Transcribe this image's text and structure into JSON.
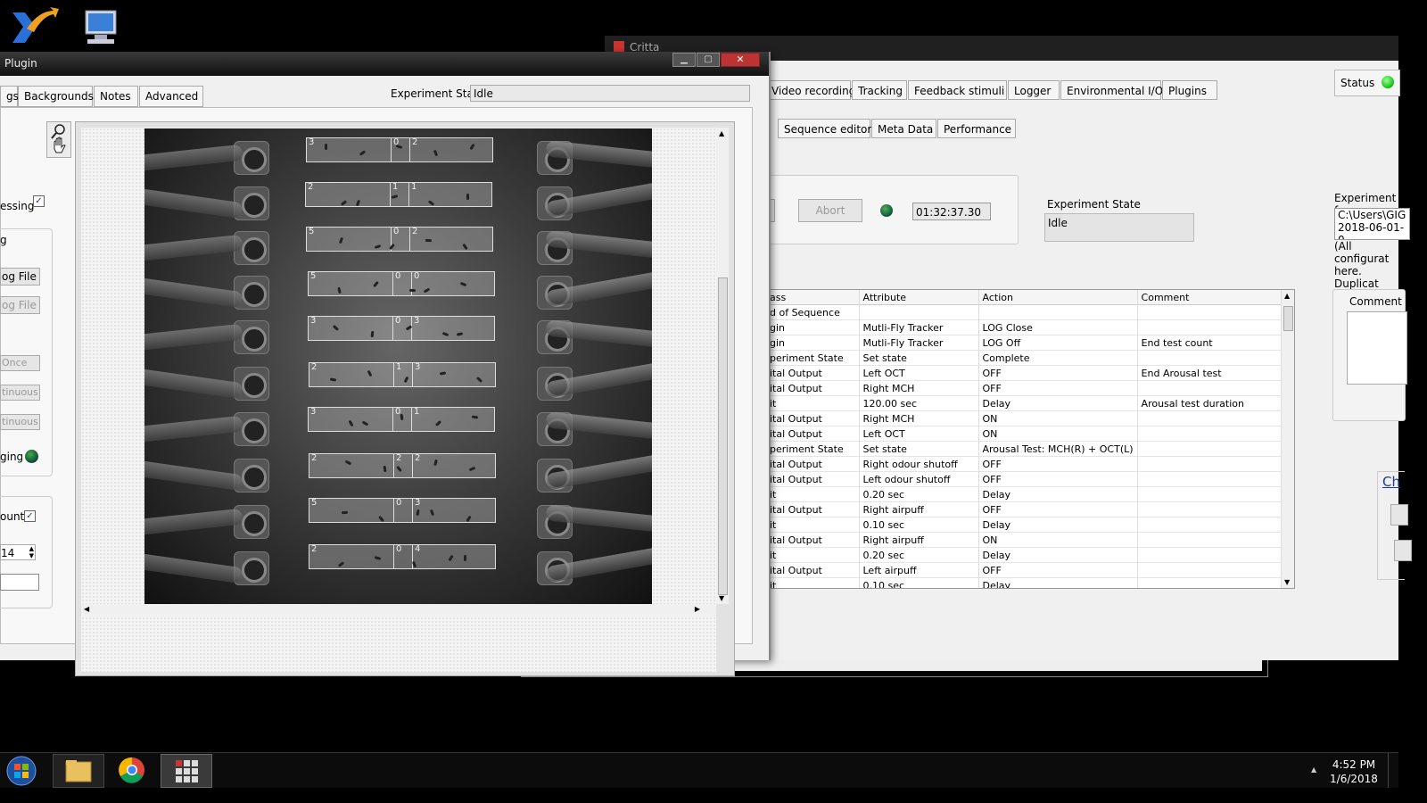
{
  "desktop": {
    "icons": [
      {
        "name": "app-shortcut-icon"
      },
      {
        "name": "computer-icon",
        "label": "Computer"
      }
    ]
  },
  "back_window": {
    "title": "Critta",
    "status_label": "Status",
    "status_color": "#22cc22",
    "tabs": [
      "Video recording",
      "Tracking",
      "Feedback stimuli",
      "Logger",
      "Environmental I/O",
      "Plugins"
    ],
    "subtabs": [
      "Sequence editor",
      "Meta Data",
      "Performance"
    ],
    "abort_label": "Abort",
    "timer_value": "01:32:37.30",
    "experiment_state_label": "Experiment State",
    "experiment_state_value": "Idle",
    "experiment_folder_label": "Experiment fo",
    "experiment_folder_value_1": "C:\\Users\\GIG",
    "experiment_folder_value_2": "2018-06-01-0",
    "experiment_note_1": "(All configurat",
    "experiment_note_2": "here. Duplicat",
    "comment_label": "Comment",
    "ch_label": "Ch",
    "table": {
      "headers": [
        "ass",
        "Attribute",
        "Action",
        "Comment"
      ],
      "rows": [
        [
          "d of Sequence",
          "",
          "",
          ""
        ],
        [
          "gin",
          "Mutli-Fly Tracker",
          "LOG Close",
          ""
        ],
        [
          "gin",
          "Mutli-Fly Tracker",
          "LOG Off",
          "End test count"
        ],
        [
          "periment State",
          "Set state",
          "Complete",
          ""
        ],
        [
          "ital Output",
          "Left OCT",
          "OFF",
          "End Arousal test"
        ],
        [
          "ital Output",
          "Right MCH",
          "OFF",
          ""
        ],
        [
          "it",
          "120.00 sec",
          "Delay",
          "Arousal test duration"
        ],
        [
          "ital Output",
          "Right MCH",
          "ON",
          ""
        ],
        [
          "ital Output",
          "Left OCT",
          "ON",
          ""
        ],
        [
          "periment State",
          "Set state",
          "Arousal Test: MCH(R) + OCT(L)",
          ""
        ],
        [
          "ital Output",
          "Right odour shutoff",
          "OFF",
          ""
        ],
        [
          "ital Output",
          "Left odour shutoff",
          "OFF",
          ""
        ],
        [
          "it",
          "0.20 sec",
          "Delay",
          ""
        ],
        [
          "ital Output",
          "Right airpuff",
          "OFF",
          ""
        ],
        [
          "it",
          "0.10 sec",
          "Delay",
          ""
        ],
        [
          "ital Output",
          "Right airpuff",
          "ON",
          ""
        ],
        [
          "it",
          "0.20 sec",
          "Delay",
          ""
        ],
        [
          "ital Output",
          "Left airpuff",
          "OFF",
          ""
        ],
        [
          "it",
          "0.10 sec",
          "Delay",
          ""
        ]
      ]
    }
  },
  "front_window": {
    "title": "Plugin",
    "tabs": [
      "gs",
      "Backgrounds",
      "Notes",
      "Advanced"
    ],
    "experiment_state_label": "Experiment State",
    "experiment_state_value": "Idle",
    "left_panel": {
      "processing_label": "essing",
      "processing_checked": true,
      "group_label": "g",
      "log_file_button": "og File",
      "log_file_button_2": "og File",
      "once_button": "Once",
      "continuous_button_1": "tinuous",
      "continuous_button_2": "tinuous",
      "logging_label": "ging",
      "logging_led_color": "#1e5a1e",
      "count_label": "ount",
      "count_checked": true,
      "spinner_value": "14"
    },
    "rois": [
      [
        "3",
        "0",
        "2"
      ],
      [
        "2",
        "1",
        "1"
      ],
      [
        "5",
        "0",
        "2"
      ],
      [
        "5",
        "0",
        "0"
      ],
      [
        "3",
        "0",
        "3"
      ],
      [
        "2",
        "1",
        "3"
      ],
      [
        "3",
        "0",
        "1"
      ],
      [
        "2",
        "2",
        "2"
      ],
      [
        "5",
        "0",
        "3"
      ],
      [
        "2",
        "0",
        "4"
      ]
    ]
  },
  "taskbar": {
    "time": "4:52 PM",
    "date": "1/6/2018",
    "apps": [
      "start-button",
      "file-explorer",
      "chrome",
      "crittaf-app"
    ]
  }
}
